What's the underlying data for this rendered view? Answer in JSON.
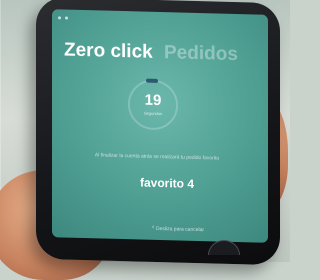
{
  "app": {
    "tabs": [
      {
        "label": "Zero click",
        "active": true
      },
      {
        "label": "Pedidos",
        "active": false
      }
    ],
    "countdown": {
      "value": "19",
      "unit": "Segundos"
    },
    "instructions": "Al finalizar la cuenta atrás se realizará tu pedido favorito",
    "favorite_label": "favorito 4",
    "bottom_hint": "Desliza para cancelar"
  },
  "colors": {
    "screen_teal": "#4f9f93",
    "countdown_progress": "#2d5a70"
  }
}
